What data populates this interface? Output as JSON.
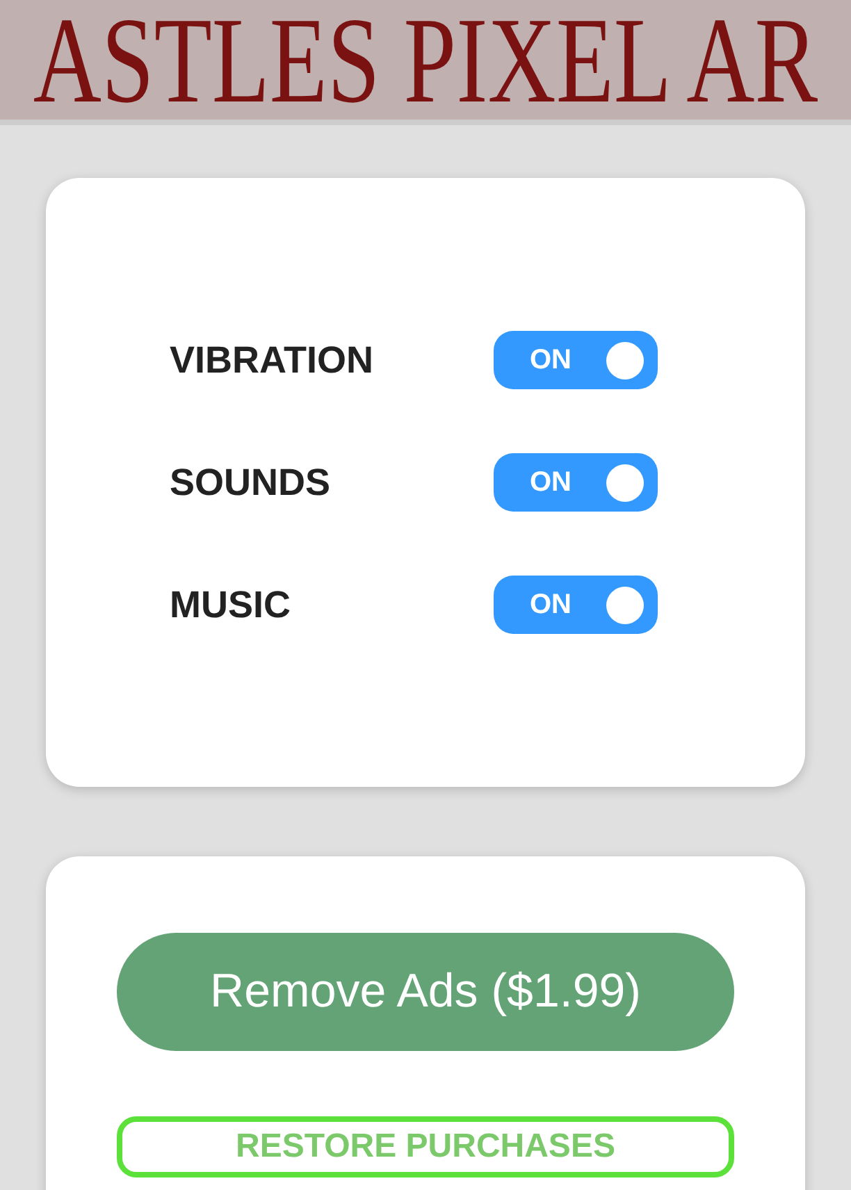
{
  "header": {
    "title": "ASTLES PIXEL AR"
  },
  "settings": [
    {
      "label": "VIBRATION",
      "toggle": {
        "text": "ON",
        "on": true
      }
    },
    {
      "label": "SOUNDS",
      "toggle": {
        "text": "ON",
        "on": true
      }
    },
    {
      "label": "MUSIC",
      "toggle": {
        "text": "ON",
        "on": true
      }
    }
  ],
  "purchases": [
    {
      "kind": "filled",
      "label": "Remove Ads ($1.99)"
    },
    {
      "kind": "outline",
      "label": "RESTORE PURCHASES"
    }
  ]
}
